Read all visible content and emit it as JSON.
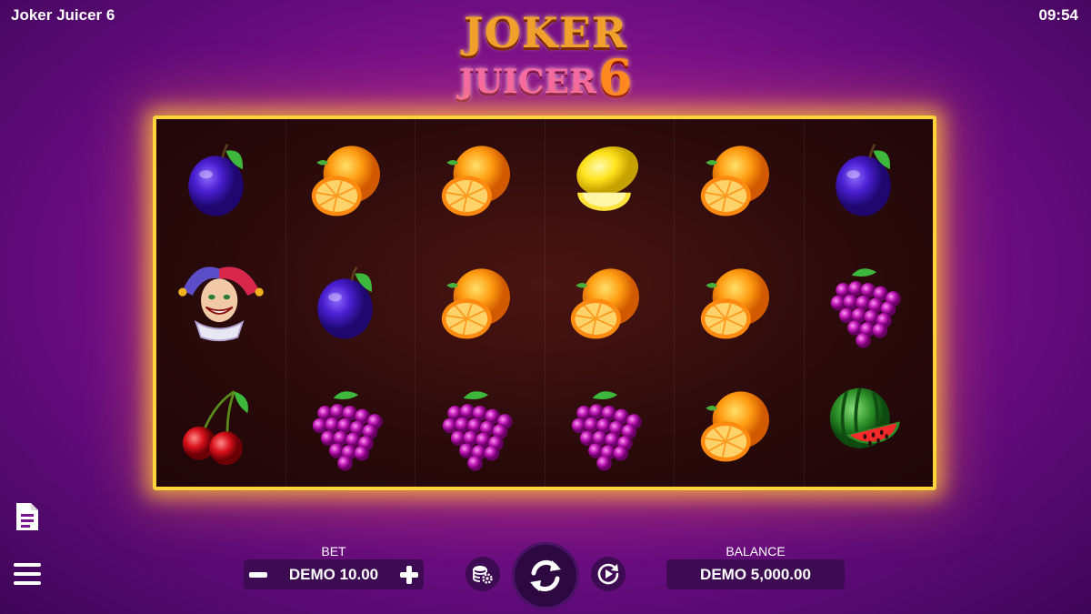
{
  "header": {
    "title": "Joker Juicer 6",
    "time": "09:54"
  },
  "logo": {
    "line1": "JOKER",
    "line2": "JUICER",
    "number": "6"
  },
  "reels": [
    [
      "plum",
      "joker",
      "cherries"
    ],
    [
      "orange",
      "plum",
      "grapes"
    ],
    [
      "orange",
      "orange",
      "grapes"
    ],
    [
      "lemon",
      "orange",
      "grapes"
    ],
    [
      "orange",
      "orange",
      "orange"
    ],
    [
      "plum",
      "grapes",
      "watermelon"
    ]
  ],
  "controls": {
    "bet_label": "BET",
    "bet_value": "DEMO 10.00",
    "balance_label": "BALANCE",
    "balance_value": "DEMO 5,000.00"
  },
  "icons": {
    "paytable": "document-icon",
    "menu": "hamburger-menu-icon",
    "minus": "minus-icon",
    "plus": "plus-icon",
    "coins": "coin-settings-icon",
    "spin": "spin-arrows-icon",
    "autoplay": "autoplay-icon"
  }
}
